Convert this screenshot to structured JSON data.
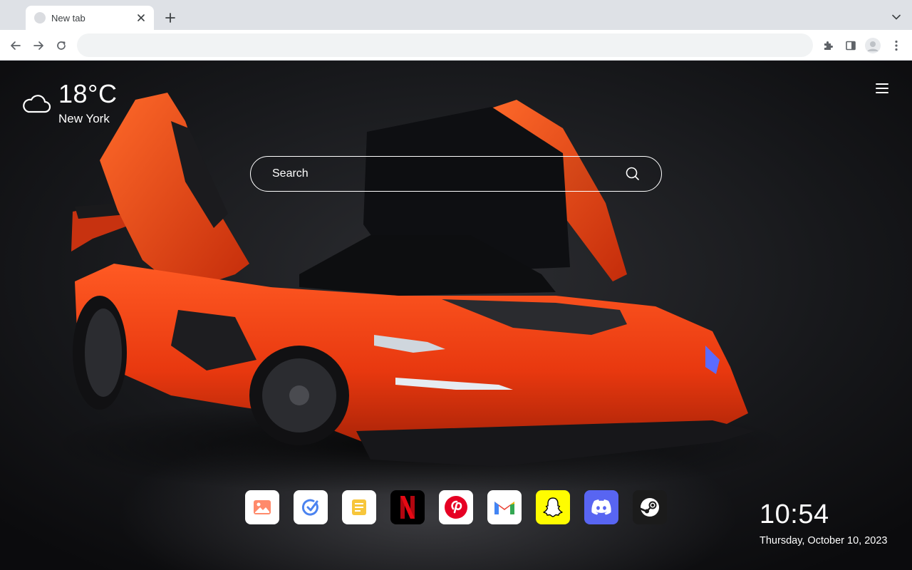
{
  "browser": {
    "tab": {
      "title": "New tab"
    },
    "omnibox": {
      "value": ""
    }
  },
  "weather": {
    "icon": "cloud-icon",
    "temperature": "18°C",
    "city": "New York"
  },
  "search": {
    "placeholder": "Search"
  },
  "quick_links": [
    {
      "name": "photo-app",
      "icon": "image-icon",
      "bg": "#ffffff"
    },
    {
      "name": "todo-app",
      "icon": "check-circle-icon",
      "bg": "#ffffff"
    },
    {
      "name": "notes-app",
      "icon": "note-icon",
      "bg": "#ffffff"
    },
    {
      "name": "netflix",
      "icon": "netflix-icon",
      "bg": "#000000"
    },
    {
      "name": "pinterest",
      "icon": "pinterest-icon",
      "bg": "#ffffff"
    },
    {
      "name": "gmail",
      "icon": "gmail-icon",
      "bg": "#ffffff"
    },
    {
      "name": "snapchat",
      "icon": "snapchat-icon",
      "bg": "#fffc00"
    },
    {
      "name": "discord",
      "icon": "discord-icon",
      "bg": "#5865f2"
    },
    {
      "name": "steam",
      "icon": "steam-icon",
      "bg": "#1b1b1b"
    }
  ],
  "clock": {
    "time": "10:54",
    "date": "Thursday, October 10, 2023"
  },
  "colors": {
    "car_body": "#e8380f",
    "background": "#1a1b1e"
  }
}
